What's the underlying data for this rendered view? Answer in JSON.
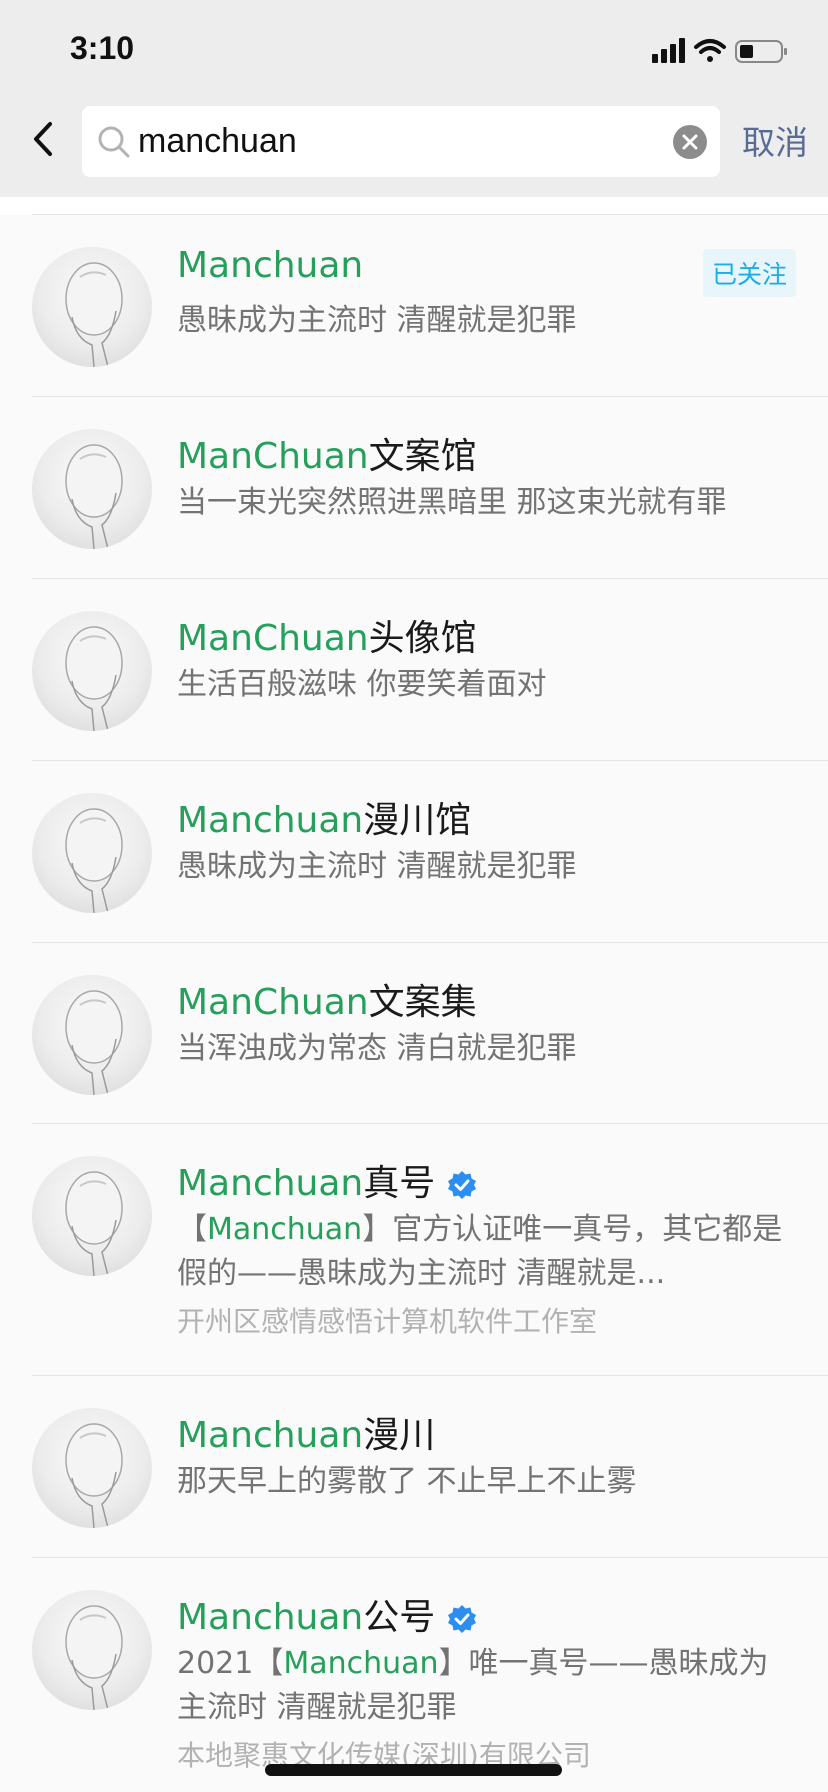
{
  "status": {
    "time": "3:10"
  },
  "search": {
    "query": "manchuan",
    "cancel_label": "取消"
  },
  "results": [
    {
      "name_hl": "Manchuan",
      "name_rest": "",
      "desc": "愚昧成为主流时 清醒就是犯罪",
      "badge": "已关注"
    },
    {
      "name_hl": "ManChuan",
      "name_rest": "文案馆",
      "desc": "当一束光突然照进黑暗里 那这束光就有罪"
    },
    {
      "name_hl": "ManChuan",
      "name_rest": "头像馆",
      "desc": "生活百般滋味 你要笑着面对"
    },
    {
      "name_hl": "Manchuan",
      "name_rest": "漫川馆",
      "desc": "愚昧成为主流时 清醒就是犯罪"
    },
    {
      "name_hl": "ManChuan",
      "name_rest": "文案集",
      "desc": "当浑浊成为常态 清白就是犯罪"
    },
    {
      "name_hl": "Manchuan",
      "name_rest": "真号",
      "verified": true,
      "desc_pre": "【",
      "desc_hl": "Manchuan",
      "desc_post": "】官方认证唯一真号，其它都是假的——愚昧成为主流时 清醒就是...",
      "org": "开州区感情感悟计算机软件工作室"
    },
    {
      "name_hl": "Manchuan",
      "name_rest": "漫川",
      "desc": "那天早上的雾散了 不止早上不止雾"
    },
    {
      "name_hl": "Manchuan",
      "name_rest": "公号",
      "verified": true,
      "desc_pre": "2021【",
      "desc_hl": "Manchuan",
      "desc_post": "】唯一真号——愚昧成为主流时 清醒就是犯罪",
      "org": "本地聚惠文化传媒(深圳)有限公司"
    }
  ]
}
